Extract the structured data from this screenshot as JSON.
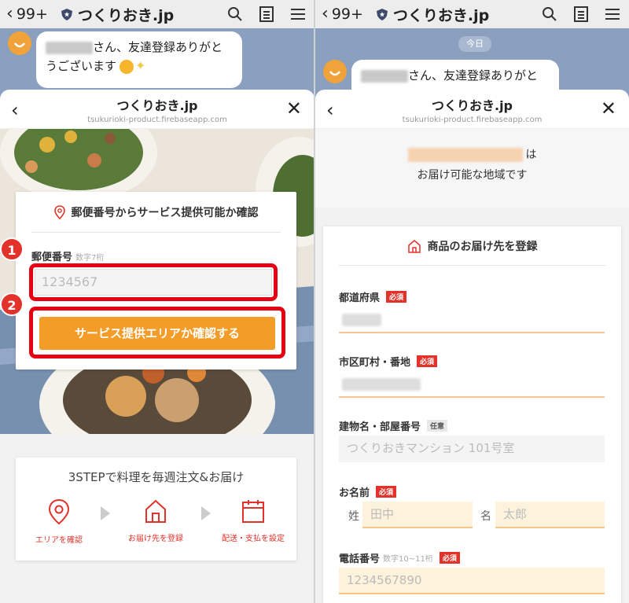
{
  "line": {
    "back_count": "99+",
    "chat_title": "つくりおき.jp"
  },
  "chat": {
    "greeting_line1": "さん、友達登録ありがと",
    "greeting_line2": "うございます",
    "date_label": "今日"
  },
  "modal": {
    "title": "つくりおき.jp",
    "url": "tsukurioki-product.firebaseapp.com"
  },
  "zip_card": {
    "title": "郵便番号からサービス提供可能か確認",
    "field_label": "郵便番号",
    "field_hint": "数字7桁",
    "placeholder": "1234567",
    "button_label": "サービス提供エリアか確認する",
    "marker_1": "1",
    "marker_2": "2"
  },
  "steps": {
    "title": "3STEPで料理を毎週注文&お届け",
    "items": [
      {
        "label": "エリアを確認",
        "icon": "location-pin-icon"
      },
      {
        "label": "お届け先を登録",
        "icon": "house-icon"
      },
      {
        "label": "配送・支払を設定",
        "icon": "calendar-icon"
      }
    ]
  },
  "result": {
    "suffix": "は",
    "message": "お届け可能な地域です"
  },
  "register_form": {
    "title": "商品のお届け先を登録",
    "prefecture_label": "都道府県",
    "city_label": "市区町村・番地",
    "building_label": "建物名・部屋番号",
    "building_placeholder": "つくりおきマンション 101号室",
    "name_label": "お名前",
    "last_name_prefix": "姓",
    "last_name_placeholder": "田中",
    "first_name_prefix": "名",
    "first_name_placeholder": "太郎",
    "phone_label": "電話番号",
    "phone_hint": "数字10~11桁",
    "phone_placeholder": "1234567890",
    "required_badge": "必須",
    "optional_badge": "任意"
  },
  "colors": {
    "accent_orange": "#f39c28",
    "accent_red": "#e3322a",
    "highlight_red": "#e60012",
    "field_bg": "#fdf3dc"
  }
}
